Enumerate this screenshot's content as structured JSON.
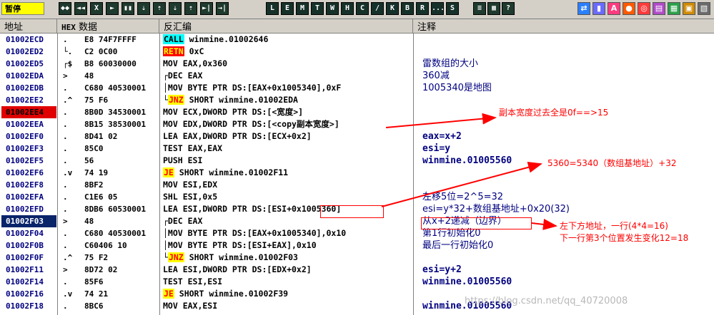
{
  "toolbar": {
    "status": "暂停",
    "buttons_left": [
      "◆◆",
      "◄◄",
      "X",
      "►",
      "▮▮",
      "⇣",
      "⇡",
      "⇣",
      "⇡",
      "►|",
      "→|"
    ],
    "buttons_letters": [
      "L",
      "E",
      "M",
      "T",
      "W",
      "H",
      "C",
      "/",
      "K",
      "B",
      "R",
      "...",
      "S"
    ],
    "buttons_right": [
      "≡",
      "▦",
      "?"
    ],
    "buttons_far_right": [
      "⇄",
      "▮",
      "A",
      "●",
      "◎",
      "▤",
      "▦",
      "▣",
      "▧"
    ]
  },
  "header": {
    "address": "地址",
    "hex_prefix": "HEX",
    "hex_label": "数据",
    "disasm": "反汇编",
    "comment": "注释"
  },
  "rows": [
    {
      "addr": "01002ECD",
      "mark": ".",
      "hex": "E8 74F7FFFF",
      "asm": [
        {
          "kw": "CALL",
          "style": "call"
        },
        {
          "t": " winmine.01002646"
        }
      ],
      "cmt": ""
    },
    {
      "addr": "01002ED2",
      "mark": "└.",
      "hex": "C2 0C00",
      "asm": [
        {
          "kw": "RETN",
          "style": "retn"
        },
        {
          "t": " 0xC"
        }
      ],
      "cmt": ""
    },
    {
      "addr": "01002ED5",
      "mark": "┌$",
      "hex": "B8 60030000",
      "asm": [
        {
          "t": "MOV EAX,0x360"
        }
      ],
      "cmt": "雷数组的大小"
    },
    {
      "addr": "01002EDA",
      "mark": ">",
      "hex": "48",
      "asm": [
        {
          "t": "┌DEC EAX"
        }
      ],
      "cmt": "360减"
    },
    {
      "addr": "01002EDB",
      "mark": ".",
      "hex": "C680 40530001",
      "asm": [
        {
          "t": "│MOV BYTE PTR DS:[EAX+0x1005340],0xF"
        }
      ],
      "cmt": "1005340是地图"
    },
    {
      "addr": "01002EE2",
      "mark": ".^",
      "hex": "75 F6",
      "asm": [
        {
          "t": "└"
        },
        {
          "kw": "JNZ",
          "style": "jmp"
        },
        {
          "t": " SHORT winmine.01002EDA"
        }
      ],
      "cmt": ""
    },
    {
      "addr": "01002EE4",
      "mark": ".",
      "hex": "8B0D 34530001",
      "asm": [
        {
          "t": "MOV ECX,DWORD PTR DS:[<宽度>]"
        }
      ],
      "cmt": "",
      "state": "bp"
    },
    {
      "addr": "01002EEA",
      "mark": ".",
      "hex": "8B15 38530001",
      "asm": [
        {
          "t": "MOV EDX,DWORD PTR DS:[<copy副本宽度>]"
        }
      ],
      "cmt": ""
    },
    {
      "addr": "01002EF0",
      "mark": ".",
      "hex": "8D41 02",
      "asm": [
        {
          "t": "LEA EAX,DWORD PTR DS:[ECX+0x2]"
        }
      ],
      "cmt": "eax=x+2"
    },
    {
      "addr": "01002EF3",
      "mark": ".",
      "hex": "85C0",
      "asm": [
        {
          "t": "TEST EAX,EAX"
        }
      ],
      "cmt": "esi=y"
    },
    {
      "addr": "01002EF5",
      "mark": ".",
      "hex": "56",
      "asm": [
        {
          "t": "PUSH ESI"
        }
      ],
      "cmt": "winmine.01005560"
    },
    {
      "addr": "01002EF6",
      "mark": ".v",
      "hex": "74 19",
      "asm": [
        {
          "kw": "JE",
          "style": "jmp"
        },
        {
          "t": " SHORT winmine.01002F11"
        }
      ],
      "cmt": ""
    },
    {
      "addr": "01002EF8",
      "mark": ".",
      "hex": "8BF2",
      "asm": [
        {
          "t": "MOV ESI,EDX"
        }
      ],
      "cmt": ""
    },
    {
      "addr": "01002EFA",
      "mark": ".",
      "hex": "C1E6 05",
      "asm": [
        {
          "t": "SHL ESI,0x5"
        }
      ],
      "cmt": "左移5位=2^5=32"
    },
    {
      "addr": "01002EFD",
      "mark": ".",
      "hex": "8DB6 60530001",
      "asm": [
        {
          "t": "LEA ESI,DWORD PTR DS:[ESI+0x1005360]"
        }
      ],
      "cmt": "esi=y*32+数组基地址+0x20(32)"
    },
    {
      "addr": "01002F03",
      "mark": ">",
      "hex": "48",
      "asm": [
        {
          "t": "┌DEC EAX"
        }
      ],
      "cmt": "从x+2递减（边界）",
      "state": "sel"
    },
    {
      "addr": "01002F04",
      "mark": ".",
      "hex": "C680 40530001",
      "asm": [
        {
          "t": "│MOV BYTE PTR DS:[EAX+0x1005340],0x10"
        }
      ],
      "cmt": "第1行初始化0"
    },
    {
      "addr": "01002F0B",
      "mark": ".",
      "hex": "C60406 10",
      "asm": [
        {
          "t": "│MOV BYTE PTR DS:[ESI+EAX],0x10"
        }
      ],
      "cmt": "最后一行初始化0"
    },
    {
      "addr": "01002F0F",
      "mark": ".^",
      "hex": "75 F2",
      "asm": [
        {
          "t": "└"
        },
        {
          "kw": "JNZ",
          "style": "jmp"
        },
        {
          "t": " SHORT winmine.01002F03"
        }
      ],
      "cmt": ""
    },
    {
      "addr": "01002F11",
      "mark": ">",
      "hex": "8D72 02",
      "asm": [
        {
          "t": "LEA ESI,DWORD PTR DS:[EDX+0x2]"
        }
      ],
      "cmt": "esi=y+2"
    },
    {
      "addr": "01002F14",
      "mark": ".",
      "hex": "85F6",
      "asm": [
        {
          "t": "TEST ESI,ESI"
        }
      ],
      "cmt": "winmine.01005560"
    },
    {
      "addr": "01002F16",
      "mark": ".v",
      "hex": "74 21",
      "asm": [
        {
          "kw": "JE",
          "style": "jmp"
        },
        {
          "t": " SHORT winmine.01002F39"
        }
      ],
      "cmt": ""
    },
    {
      "addr": "01002F18",
      "mark": ".",
      "hex": "8BC6",
      "asm": [
        {
          "t": "MOV EAX,ESI"
        }
      ],
      "cmt": "winmine.01005560"
    }
  ],
  "annotations": {
    "a1": "副本宽度过去全是0f==>15",
    "a2": "5360=5340（数组基地址）+32",
    "a3_line1": "左下方地址，一行(4*4=16)",
    "a3_line2": "下一行第3个位置发生变化12=18"
  },
  "watermark": "https://blog.csdn.net/qq_40720008",
  "colors": {
    "address": "#000080",
    "selected": "#0a246a",
    "breakpoint": "#e00000",
    "annotation": "#ff0000"
  }
}
